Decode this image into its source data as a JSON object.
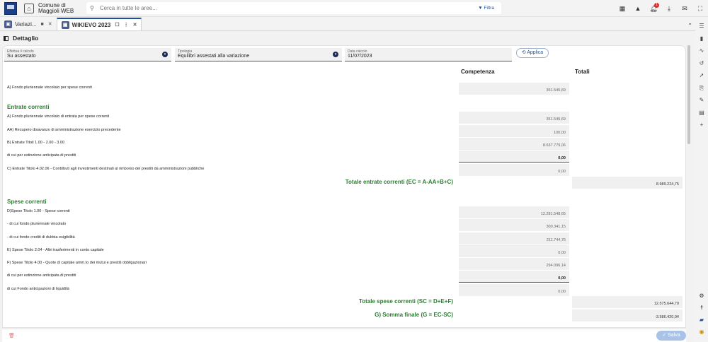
{
  "header": {
    "app_title_line1": "Comune di",
    "app_title_line2": "Maggioli WEB",
    "logo_text": "Maggioli",
    "search_placeholder": "Cerca in tutte le aree...",
    "filter_label": "Filtra",
    "notification_count": "1"
  },
  "tabs": [
    {
      "label": "Variazi...",
      "icon": "bookmark-icon"
    },
    {
      "label": "WIKIEVO 2023",
      "icon": "tab-icon"
    }
  ],
  "detail_title": "Dettaglio",
  "filters": {
    "calcolo": {
      "label": "Effettua il calcolo",
      "value": "Su assestato"
    },
    "tipologia": {
      "label": "Tipologia",
      "value": "Equilibri assestati alla variazione"
    },
    "data": {
      "label": "Data calcolo",
      "value": "11/07/2023"
    },
    "apply_label": "Applica"
  },
  "columns": {
    "competenza": "Competenza",
    "totali": "Totali"
  },
  "rows": {
    "fpv_spese": {
      "label": "A) Fondo pluriennale vincolato per spese correnti",
      "value": "351.545,69"
    },
    "entrate_title": "Entrate correnti",
    "fpv_entrata": {
      "label": "A) Fondo pluriennale vincolato di entrata per spese correnti",
      "value": "351.545,69"
    },
    "aa": {
      "label": "AA) Recupero disavanzo di amministrazione esercizio precedente",
      "value": "100,00"
    },
    "b": {
      "label": "B) Entrate Titoli 1.00 - 2.00 - 3.00",
      "value": "8.637.779,06"
    },
    "b_estinzione": {
      "label": "di cui per estinzione anticipata di prestiti",
      "value": "0,00"
    },
    "c": {
      "label": "C) Entrate Titolo 4.02.06 - Contributi agli investimenti destinati al rimborso dei prestiti da amministrazioni pubbliche",
      "value": "0,00"
    },
    "tot_entrate": {
      "label": "Totale entrate correnti (EC = A-AA+B+C)",
      "value": "8.989.224,75"
    },
    "spese_title": "Spese correnti",
    "d": {
      "label": "D)Spese Titolo 1.00 - Spese correnti",
      "value": "12.281.548,65"
    },
    "d_fpv": {
      "label": "- di cui fondo pluriennale vincolato",
      "value": "300.341,15"
    },
    "d_fcde": {
      "label": "- di cui fondo crediti di dubbia esigibilità",
      "value": "211.744,76"
    },
    "e": {
      "label": "E) Spese Titolo 2.04 - Altri trasferimenti in conto capitale",
      "value": "0,00"
    },
    "f": {
      "label": "F) Spese Titolo 4.00 - Quote di capitale amm.to dei mutui e prestiti obbligazionari",
      "value": "294.096,14"
    },
    "f_estinzione": {
      "label": "di cui per estinzione anticipata di prestiti",
      "value": "0,00"
    },
    "f_liquidita": {
      "label": "di cui Fondo anticipazioni di liquidità",
      "value": "0,00"
    },
    "tot_spese": {
      "label": "Totale spese correnti (SC = D+E+F)",
      "value": "12.575.644,79"
    },
    "somma_finale": {
      "label": "G) Somma finale (G = EC-SC)",
      "value": "-3.586.420,04"
    }
  },
  "footer": {
    "save_label": "Salva"
  }
}
